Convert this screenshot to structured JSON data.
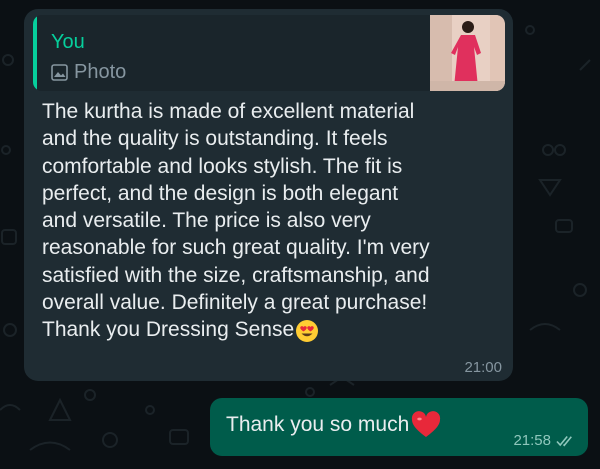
{
  "reply_quote": {
    "author": "You",
    "media_label": "Photo",
    "media_icon": "photo-icon"
  },
  "incoming": {
    "text": "The kurtha is made of excellent material\nand the quality is outstanding. It feels\ncomfortable and looks stylish. The fit is\nperfect, and the design is both elegant\nand versatile. The price is also very\nreasonable for such great quality. I'm very\nsatisfied with the size, craftsmanship, and\noverall value. Definitely a great purchase!\nThank you Dressing Sense",
    "emoji": "heart-eyes-emoji",
    "time": "21:00"
  },
  "outgoing": {
    "text": "Thank you so much",
    "emoji": "red-heart-emoji",
    "time": "21:58",
    "status_icon": "double-check-icon"
  },
  "colors": {
    "background": "#0b1014",
    "incoming_bubble": "#1f2c33",
    "outgoing_bubble": "#005c4b",
    "quote_accent": "#06cf9c"
  }
}
